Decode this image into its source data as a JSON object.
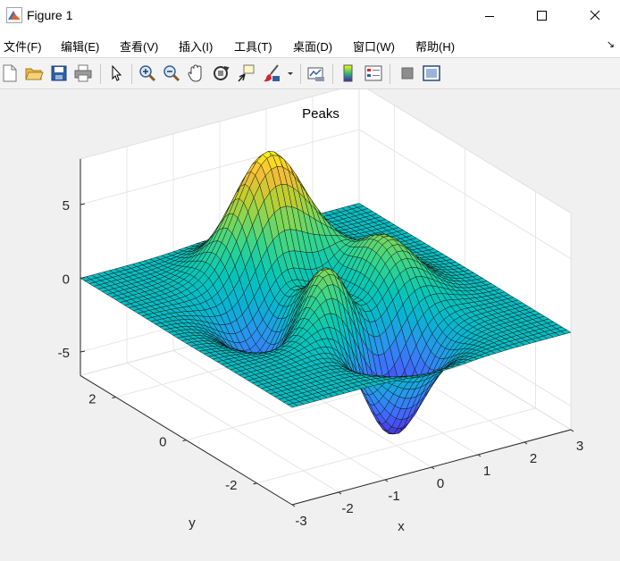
{
  "window": {
    "title": "Figure 1"
  },
  "menu": [
    {
      "label": "文件(F)"
    },
    {
      "label": "编辑(E)"
    },
    {
      "label": "查看(V)"
    },
    {
      "label": "插入(I)"
    },
    {
      "label": "工具(T)"
    },
    {
      "label": "桌面(D)"
    },
    {
      "label": "窗口(W)"
    },
    {
      "label": "帮助(H)"
    }
  ],
  "toolbar": {
    "icons": [
      "new-figure-icon",
      "open-folder-icon",
      "save-icon",
      "print-icon",
      "pointer-icon",
      "zoom-in-icon",
      "zoom-out-icon",
      "pan-hand-icon",
      "rotate-3d-icon",
      "data-cursor-icon",
      "brush-icon",
      "dropdown-arrow-icon",
      "link-plot-icon",
      "colorbar-icon",
      "legend-icon",
      "hide-tools-icon",
      "show-tools-icon"
    ]
  },
  "chart_data": {
    "type": "surface",
    "title": "Peaks",
    "function": "peaks(x,y)",
    "grid_size": 49,
    "colormap": "parula",
    "grid": true,
    "xlabel": "x",
    "ylabel": "y",
    "zlabel": "",
    "xlim": [
      -3,
      3
    ],
    "ylim": [
      -3,
      3
    ],
    "zlim": [
      -6.6,
      8.1
    ],
    "xticks": [
      "-3",
      "-2",
      "-1",
      "0",
      "1",
      "2",
      "3"
    ],
    "yticks": [
      "-2",
      "0",
      "2"
    ],
    "zticks": [
      "-5",
      "0",
      "5"
    ],
    "view": {
      "azimuth": -37.5,
      "elevation": 30
    }
  }
}
